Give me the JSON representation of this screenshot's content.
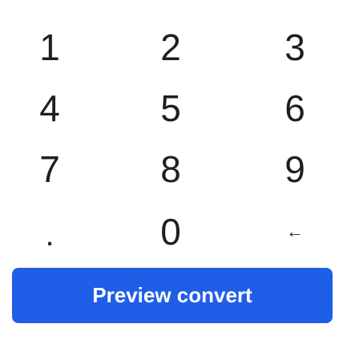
{
  "keypad": {
    "keys": [
      "1",
      "2",
      "3",
      "4",
      "5",
      "6",
      "7",
      "8",
      "9",
      ".",
      "0",
      "←"
    ]
  },
  "actions": {
    "preview_label": "Preview convert"
  },
  "colors": {
    "accent": "#1f5ee6",
    "text": "#1f1f1f",
    "background": "#ffffff"
  }
}
